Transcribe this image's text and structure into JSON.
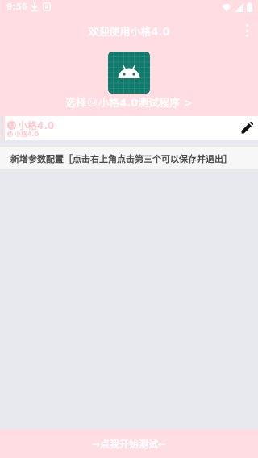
{
  "status_bar": {
    "time": "9:56",
    "icons": [
      "download-icon",
      "notification-icon",
      "wifi-icon",
      "signal-icon",
      "battery-icon"
    ]
  },
  "app_bar": {
    "title": "欢迎使用小格4.0",
    "menu_icon": "more-vert-icon"
  },
  "header": {
    "icon": "android-app-icon",
    "choose_prefix": "选择",
    "choose_suffix": "小格4.0测试程序 >"
  },
  "config_card": {
    "name": "小格4.0",
    "sub_name": "小格4.0",
    "edit_icon": "edit-pencil-icon"
  },
  "add_config": {
    "text": "新增参数配置［点击右上角点击第三个可以保存并退出］"
  },
  "bottom_bar": {
    "label": "→点我开始测试←"
  },
  "colors": {
    "primary_pink": "#ffdde3",
    "accent_pink": "#ffc9d2",
    "icon_teal": "#127a6c",
    "background": "#e8e9ee",
    "text_dark": "#4b4b4b"
  }
}
